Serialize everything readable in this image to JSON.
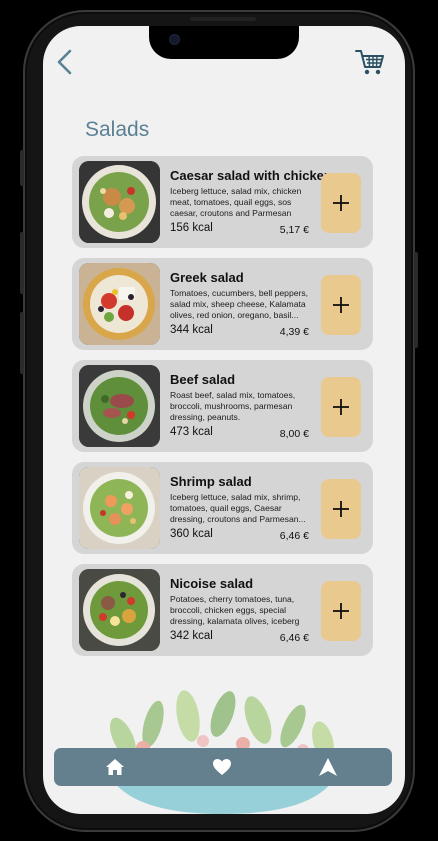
{
  "header": {
    "back_icon": "chevron-left-icon",
    "cart_icon": "shopping-cart-icon"
  },
  "page": {
    "title": "Salads"
  },
  "items": [
    {
      "name": "Caesar salad with chicken",
      "description": "Iceberg lettuce, salad mix, chicken meat, tomatoes, quail eggs, sos caesar, croutons and Parmesan",
      "kcal": "156 kcal",
      "price": "5,17 €",
      "image": "caesar-salad-photo"
    },
    {
      "name": "Greek salad",
      "description": "Tomatoes, cucumbers, bell peppers, salad mix, sheep cheese, Kalamata olives, red onion, oregano, basil...",
      "kcal": "344 kcal",
      "price": "4,39 €",
      "image": "greek-salad-photo"
    },
    {
      "name": "Beef salad",
      "description": "Roast beef, salad mix, tomatoes, broccoli, mushrooms, parmesan dressing, peanuts.",
      "kcal": "473 kcal",
      "price": "8,00 €",
      "image": "beef-salad-photo"
    },
    {
      "name": "Shrimp salad",
      "description": "Iceberg lettuce, salad mix, shrimp, tomatoes, quail eggs, Caesar dressing, croutons and Parmesan...",
      "kcal": "360 kcal",
      "price": "6,46 €",
      "image": "shrimp-salad-photo"
    },
    {
      "name": "Nicoise salad",
      "description": "Potatoes, cherry tomatoes, tuna, broccoli, chicken eggs, special dressing, kalamata olives, iceberg",
      "kcal": "342 kcal",
      "price": "6,46 €",
      "image": "nicoise-salad-photo"
    }
  ],
  "add_button_icon": "plus-icon",
  "nav": {
    "items": [
      {
        "icon": "home-icon"
      },
      {
        "icon": "heart-icon"
      },
      {
        "icon": "navigation-arrow-icon"
      }
    ]
  },
  "colors": {
    "accent_title": "#5a8195",
    "card_bg": "#d5d5d5",
    "add_button": "#e9c98e",
    "navbar": "#64808f",
    "screen_bg": "#f1f1f1"
  }
}
